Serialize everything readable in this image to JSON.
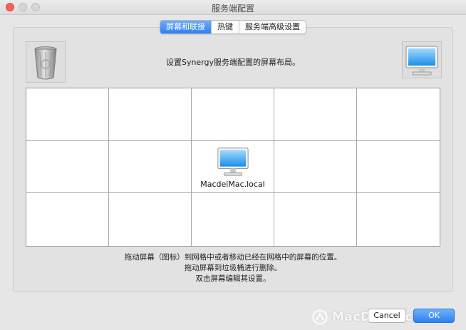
{
  "window": {
    "title": "服务端配置"
  },
  "tabs": [
    {
      "label": "屏幕和联接",
      "active": true
    },
    {
      "label": "热键",
      "active": false
    },
    {
      "label": "服务端高级设置",
      "active": false
    }
  ],
  "layout": {
    "instruction": "设置Synergy服务端配置的屏幕布局。",
    "trash_icon": "trash-can-icon",
    "new_screen_icon": "monitor-icon",
    "grid": {
      "rows": 3,
      "columns": 5
    },
    "screens": [
      {
        "name": "MacdeiMac.local",
        "row": 1,
        "column": 2,
        "icon": "monitor-icon"
      }
    ]
  },
  "help": {
    "line1": "拖动屏幕（图标）到网格中或者移动已经在网格中的屏幕的位置。",
    "line2": "拖动屏幕到垃圾桶进行删除。",
    "line3": "双击屏幕编辑其设置。"
  },
  "buttons": {
    "cancel": "Cancel",
    "ok": "OK"
  },
  "watermark": {
    "text": "MacDown.com"
  },
  "colors": {
    "accent": "#2e7ff0",
    "close": "#fc615d"
  }
}
